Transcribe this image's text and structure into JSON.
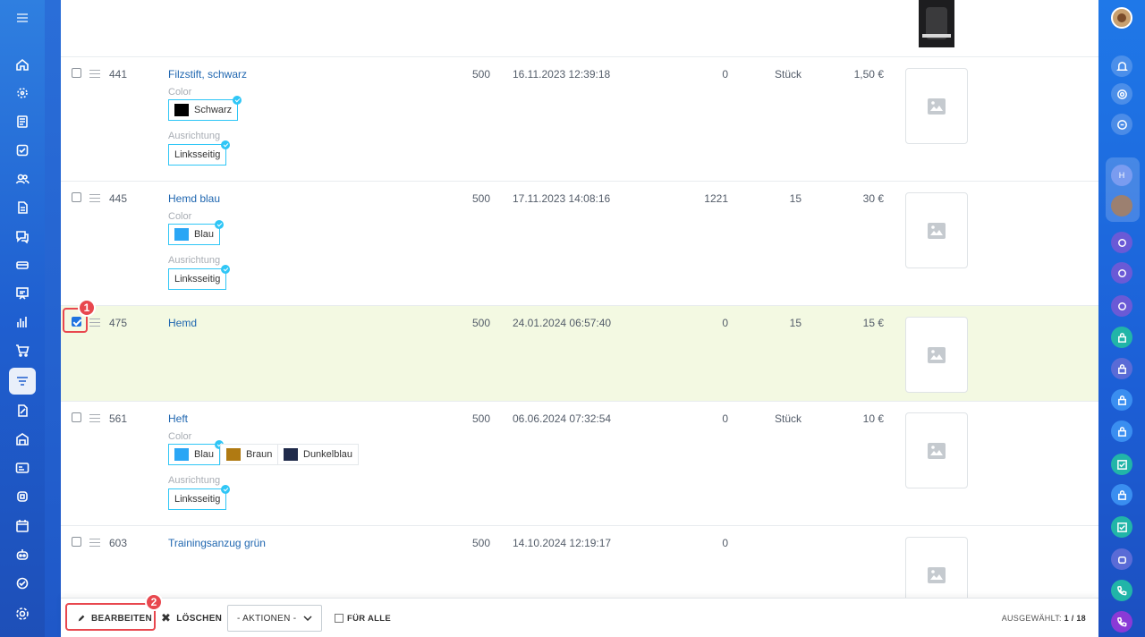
{
  "left_sidebar": {
    "items": [
      {
        "icon": "menu-icon"
      },
      {
        "icon": "home-icon"
      },
      {
        "icon": "target-icon"
      },
      {
        "icon": "feed-icon"
      },
      {
        "icon": "tasks-icon"
      },
      {
        "icon": "contacts-icon"
      },
      {
        "icon": "documents-icon"
      },
      {
        "icon": "chat-icon"
      },
      {
        "icon": "crm-icon"
      },
      {
        "icon": "presentation-icon"
      },
      {
        "icon": "analytics-icon"
      },
      {
        "icon": "cart-icon"
      },
      {
        "icon": "catalog-icon",
        "active": true
      },
      {
        "icon": "sign-icon"
      },
      {
        "icon": "warehouse-icon"
      },
      {
        "icon": "id-card-icon"
      },
      {
        "icon": "robot-icon"
      },
      {
        "icon": "calendar-icon"
      },
      {
        "icon": "bot-icon"
      },
      {
        "icon": "marketplace-icon"
      },
      {
        "icon": "settings-icon"
      }
    ]
  },
  "table": {
    "rows": [
      {
        "id": "441",
        "name": "Filzstift, schwarz",
        "sort": "500",
        "date": "16.11.2023 12:39:18",
        "quantity": "0",
        "unit_or_qty": "Stück",
        "price": "1,50 €",
        "checked": false,
        "properties": [
          {
            "label": "Color",
            "values": [
              {
                "text": "Schwarz",
                "swatch": "#000000",
                "selected": true
              }
            ]
          },
          {
            "label": "Ausrichtung",
            "values": [
              {
                "text": "Linksseitig",
                "selected": true
              }
            ]
          }
        ]
      },
      {
        "id": "445",
        "name": "Hemd blau",
        "sort": "500",
        "date": "17.11.2023 14:08:16",
        "quantity": "1221",
        "unit_or_qty": "15",
        "price": "30 €",
        "checked": false,
        "properties": [
          {
            "label": "Color",
            "values": [
              {
                "text": "Blau",
                "swatch": "#2aa6f5",
                "selected": true
              }
            ]
          },
          {
            "label": "Ausrichtung",
            "values": [
              {
                "text": "Linksseitig",
                "selected": true
              }
            ]
          }
        ]
      },
      {
        "id": "475",
        "name": "Hemd",
        "sort": "500",
        "date": "24.01.2024 06:57:40",
        "quantity": "0",
        "unit_or_qty": "15",
        "price": "15 €",
        "checked": true,
        "properties": []
      },
      {
        "id": "561",
        "name": "Heft",
        "sort": "500",
        "date": "06.06.2024 07:32:54",
        "quantity": "0",
        "unit_or_qty": "Stück",
        "price": "10 €",
        "checked": false,
        "properties": [
          {
            "label": "Color",
            "values": [
              {
                "text": "Blau",
                "swatch": "#2aa6f5",
                "selected": true
              },
              {
                "text": "Braun",
                "swatch": "#b07a12",
                "selected": false
              },
              {
                "text": "Dunkelblau",
                "swatch": "#1f2a4a",
                "selected": false
              }
            ]
          },
          {
            "label": "Ausrichtung",
            "values": [
              {
                "text": "Linksseitig",
                "selected": true
              }
            ]
          }
        ]
      },
      {
        "id": "603",
        "name": "Trainingsanzug grün",
        "sort": "500",
        "date": "14.10.2024 12:19:17",
        "quantity": "0",
        "unit_or_qty": "",
        "price": "",
        "checked": false,
        "properties": []
      }
    ]
  },
  "action_bar": {
    "edit_label": "BEARBEITEN",
    "delete_label": "LÖSCHEN",
    "actions_select": "- AKTIONEN -",
    "for_all_label": "FÜR ALLE",
    "selected_label": "AUSGEWÄHLT:",
    "selected_value": "1 / 18"
  },
  "annotations": {
    "badge_1": "1",
    "badge_2": "2"
  },
  "colors": {
    "accent": "#1f73e0",
    "link": "#2067b0",
    "selected_row": "#f3f9e2",
    "annotation": "#e8474e",
    "property_border": "#2fc6f6"
  }
}
